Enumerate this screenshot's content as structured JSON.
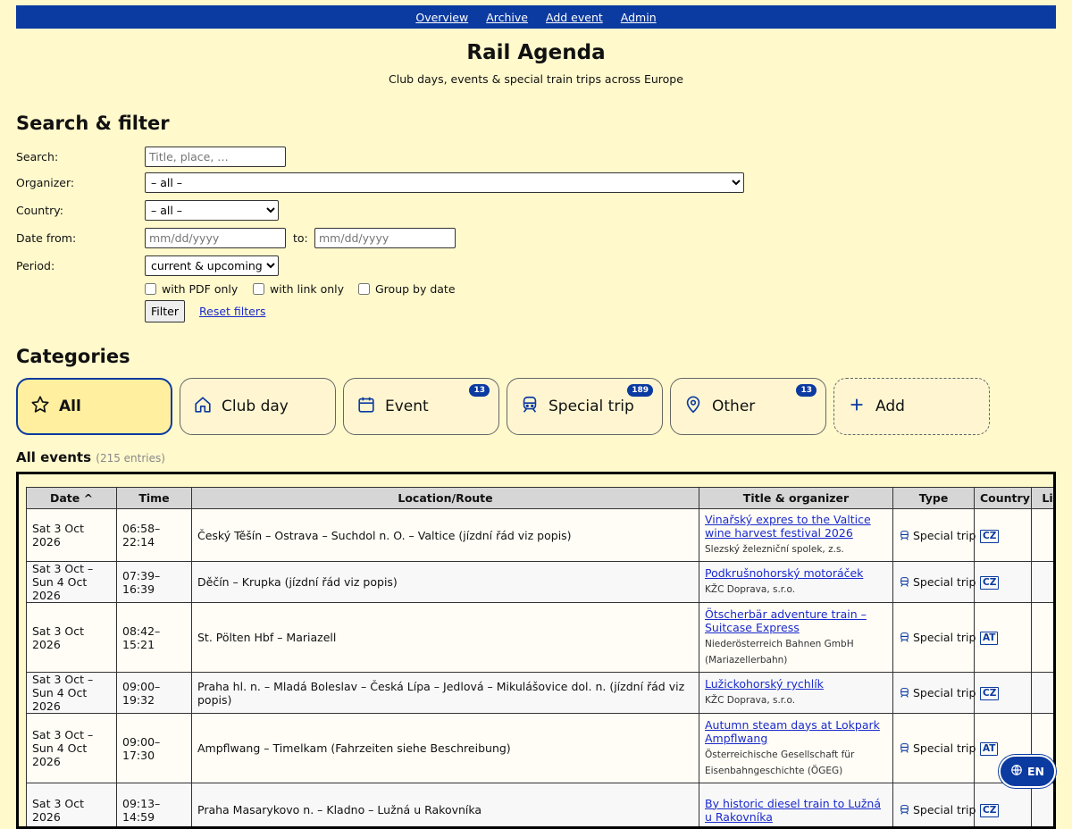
{
  "nav": {
    "items": [
      "Overview",
      "Archive",
      "Add event",
      "Admin"
    ]
  },
  "site": {
    "title": "Rail Agenda",
    "subtitle": "Club days, events & special train trips across Europe"
  },
  "filter": {
    "heading": "Search & filter",
    "search_label": "Search:",
    "search_placeholder": "Title, place, …",
    "organizer_label": "Organizer:",
    "organizer_value": "– all –",
    "country_label": "Country:",
    "country_value": "– all –",
    "date_from_label": "Date from:",
    "date_to_label": "to:",
    "date_placeholder": "mm/dd/yyyy",
    "period_label": "Period:",
    "period_value": "current & upcoming",
    "checks": [
      "with PDF only",
      "with link only",
      "Group by date"
    ],
    "filter_button": "Filter",
    "reset_link": "Reset filters"
  },
  "categories": {
    "heading": "Categories",
    "items": [
      {
        "label": "All",
        "icon": "star-icon",
        "badge": ""
      },
      {
        "label": "Club day",
        "icon": "home-icon",
        "badge": ""
      },
      {
        "label": "Event",
        "icon": "calendar-icon",
        "badge": "13"
      },
      {
        "label": "Special trip",
        "icon": "train-icon",
        "badge": "189"
      },
      {
        "label": "Other",
        "icon": "location-pin-icon",
        "badge": "13"
      },
      {
        "label": "Add",
        "icon": "plus-icon",
        "badge": ""
      }
    ]
  },
  "events": {
    "heading": "All events",
    "count": "(215 entries)",
    "columns": [
      "Date ^",
      "Time",
      "Location/Route",
      "Title & organizer",
      "Type",
      "Country",
      "Lin"
    ],
    "rows": [
      {
        "date": "Sat 3 Oct 2026",
        "time": "06:58–22:14",
        "route": "Český Těšín – Ostrava – Suchdol n. O. – Valtice (jízdní řád viz popis)",
        "title": "Vinařský expres to the Valtice wine harvest festival 2026",
        "organizer": "Slezský železniční spolek, z.s.",
        "type": "Special trip",
        "country": "CZ"
      },
      {
        "date": "Sat 3 Oct – Sun 4 Oct 2026",
        "time": "07:39–16:39",
        "route": "Děčín – Krupka (jízdní řád viz popis)",
        "title": "Podkrušnohorský motoráček",
        "organizer": "KŽC Doprava, s.r.o.",
        "type": "Special trip",
        "country": "CZ"
      },
      {
        "date": "Sat 3 Oct 2026",
        "time": "08:42–15:21",
        "route": "St. Pölten Hbf – Mariazell",
        "title": "Ötscherbär adventure train – Suitcase Express",
        "organizer": "Niederösterreich Bahnen GmbH (Mariazellerbahn)",
        "type": "Special trip",
        "country": "AT"
      },
      {
        "date": "Sat 3 Oct – Sun 4 Oct 2026",
        "time": "09:00–19:32",
        "route": "Praha hl. n. – Mladá Boleslav – Česká Lípa – Jedlová – Mikulášovice dol. n. (jízdní řád viz popis)",
        "title": "Lužickohorský rychlík",
        "organizer": "KŽC Doprava, s.r.o.",
        "type": "Special trip",
        "country": "CZ"
      },
      {
        "date": "Sat 3 Oct – Sun 4 Oct 2026",
        "time": "09:00–17:30",
        "route": "Ampflwang – Timelkam (Fahrzeiten siehe Beschreibung)",
        "title": "Autumn steam days at Lokpark Ampflwang",
        "organizer": "Österreichische Gesellschaft für Eisenbahngeschichte (ÖGEG)",
        "type": "Special trip",
        "country": "AT"
      },
      {
        "date": "Sat 3 Oct 2026",
        "time": "09:13–14:59",
        "route": "Praha Masarykovo n. – Kladno – Lužná u Rakovníka",
        "title": "By historic diesel train to Lužná u Rakovníka",
        "organizer": "",
        "type": "Special trip",
        "country": "CZ"
      }
    ]
  },
  "lang": {
    "label": "EN",
    "icon": "globe-icon"
  },
  "colors": {
    "background": "#fff9cc",
    "accent": "#0b3aa0",
    "link": "#1a2acc"
  }
}
